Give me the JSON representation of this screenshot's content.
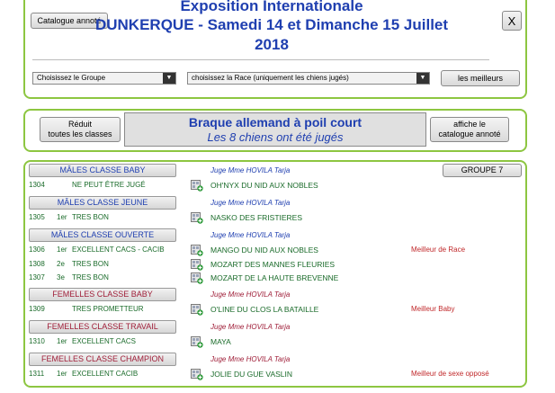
{
  "header": {
    "catalogue_button": "Catalogue annoté",
    "close_button": "X",
    "title_line1": "Exposition Internationale",
    "title_line2": "DUNKERQUE - Samedi 14 et Dimanche 15 Juillet",
    "title_line3": "2018"
  },
  "filters": {
    "group_select": "Choisissez le Groupe",
    "race_select": "choisissez la Race (uniquement les chiens jugés)",
    "best_button": "les meilleurs"
  },
  "breed_bar": {
    "reduced_button_line1": "Réduit",
    "reduced_button_line2": "toutes les classes",
    "breed_name": "Braque allemand à poil court",
    "judged_count_text": "Les 8 chiens ont été jugés",
    "show_catalogue_line1": "affiche le",
    "show_catalogue_line2": "catalogue annoté"
  },
  "group_badge": "GROUPE 7",
  "classes": [
    {
      "name": "MÂLES CLASSE BABY",
      "sex": "male",
      "judge": "Juge Mme HOVILA Tarja",
      "entries": [
        {
          "num": "1304",
          "rank": "",
          "qual": "NE PEUT ÊTRE JUGÉ",
          "dog": "OH'NYX DU NID AUX NOBLES",
          "award": ""
        }
      ]
    },
    {
      "name": "MÂLES CLASSE JEUNE",
      "sex": "male",
      "judge": "Juge Mme HOVILA Tarja",
      "entries": [
        {
          "num": "1305",
          "rank": "1er",
          "qual": "TRES BON",
          "dog": "NASKO DES FRISTIERES",
          "award": ""
        }
      ]
    },
    {
      "name": "MÂLES CLASSE OUVERTE",
      "sex": "male",
      "judge": "Juge Mme HOVILA Tarja",
      "entries": [
        {
          "num": "1306",
          "rank": "1er",
          "qual": "EXCELLENT CACS - CACIB",
          "dog": "MANGO DU NID AUX NOBLES",
          "award": "Meilleur de Race"
        },
        {
          "num": "1308",
          "rank": "2e",
          "qual": "TRES BON",
          "dog": "MOZART DES MANNES FLEURIES",
          "award": ""
        },
        {
          "num": "1307",
          "rank": "3e",
          "qual": "TRES BON",
          "dog": "MOZART DE LA HAUTE BREVENNE",
          "award": ""
        }
      ]
    },
    {
      "name": "FEMELLES CLASSE BABY",
      "sex": "female",
      "judge": "Juge Mme HOVILA Tarja",
      "entries": [
        {
          "num": "1309",
          "rank": "",
          "qual": "TRES PROMETTEUR",
          "dog": "O'LINE DU CLOS LA BATAILLE",
          "award": "Meilleur Baby"
        }
      ]
    },
    {
      "name": "FEMELLES CLASSE TRAVAIL",
      "sex": "female",
      "judge": "Juge Mme HOVILA Tarja",
      "entries": [
        {
          "num": "1310",
          "rank": "1er",
          "qual": "EXCELLENT CACS",
          "dog": "MAYA",
          "award": ""
        }
      ]
    },
    {
      "name": "FEMELLES CLASSE CHAMPION",
      "sex": "female",
      "judge": "Juge Mme HOVILA Tarja",
      "entries": [
        {
          "num": "1311",
          "rank": "1er",
          "qual": "EXCELLENT CACIB",
          "dog": "JOLIE DU GUE VASLIN",
          "award": "Meilleur de sexe opposé"
        }
      ]
    }
  ],
  "icons": {
    "entry_icon": "catalogue-add-icon",
    "select_arrow": "dropdown-arrow-icon"
  },
  "colors": {
    "panel_border": "#8dc641",
    "title_blue": "#1f3fb0",
    "female_red": "#a0203a",
    "entry_green": "#1a6b2a",
    "award_red": "#c0282a"
  }
}
